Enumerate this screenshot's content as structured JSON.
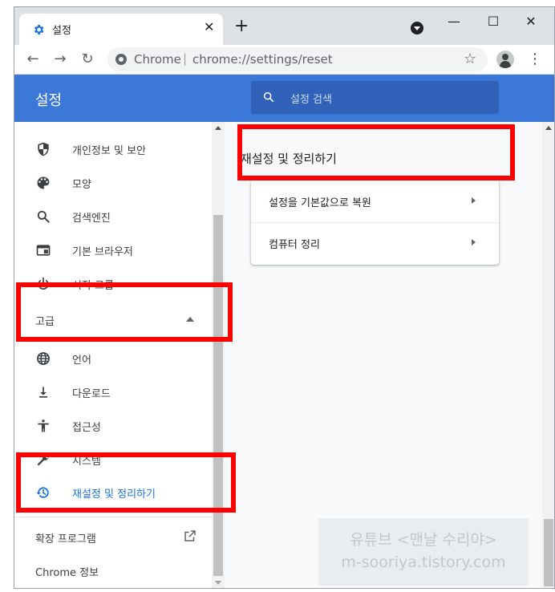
{
  "browser": {
    "tab_title": "설정",
    "tab_close": "✕",
    "new_tab": "+",
    "window_buttons": {
      "minimize": "—",
      "maximize": "☐",
      "close": "✕"
    },
    "nav": {
      "back": "←",
      "forward": "→",
      "reload": "↻"
    },
    "omnibox": {
      "brand": "Chrome",
      "separator": "|",
      "url": "chrome://settings/reset"
    },
    "bookmark_star": "☆",
    "menu": "⋮"
  },
  "settings": {
    "title": "설정",
    "search_placeholder": "설정 검색"
  },
  "sidebar": {
    "items_top": [
      {
        "label": "개인정보 및 보안",
        "icon": "shield-icon"
      },
      {
        "label": "모양",
        "icon": "palette-icon"
      },
      {
        "label": "검색엔진",
        "icon": "search-icon"
      },
      {
        "label": "기본 브라우저",
        "icon": "browser-icon"
      },
      {
        "label": "시작 그룹",
        "icon": "power-icon"
      }
    ],
    "advanced_label": "고급",
    "items_advanced": [
      {
        "label": "언어",
        "icon": "globe-icon"
      },
      {
        "label": "다운로드",
        "icon": "download-icon"
      },
      {
        "label": "접근성",
        "icon": "accessibility-icon"
      },
      {
        "label": "시스템",
        "icon": "wrench-icon"
      },
      {
        "label": "재설정 및 정리하기",
        "icon": "restore-icon",
        "active": true
      }
    ],
    "extensions_label": "확장 프로그램",
    "about_label": "Chrome 정보"
  },
  "main": {
    "section_title": "재설정 및 정리하기",
    "rows": [
      {
        "label": "설정을 기본값으로 복원"
      },
      {
        "label": "컴퓨터 정리"
      }
    ]
  },
  "watermark": {
    "line1": "유튜브 <맨날 수리야>",
    "line2": "m-sooriya.tistory.com"
  },
  "colors": {
    "header_blue": "#3c78d8",
    "active_blue": "#1a73e8",
    "highlight_red": "#ff0000"
  }
}
